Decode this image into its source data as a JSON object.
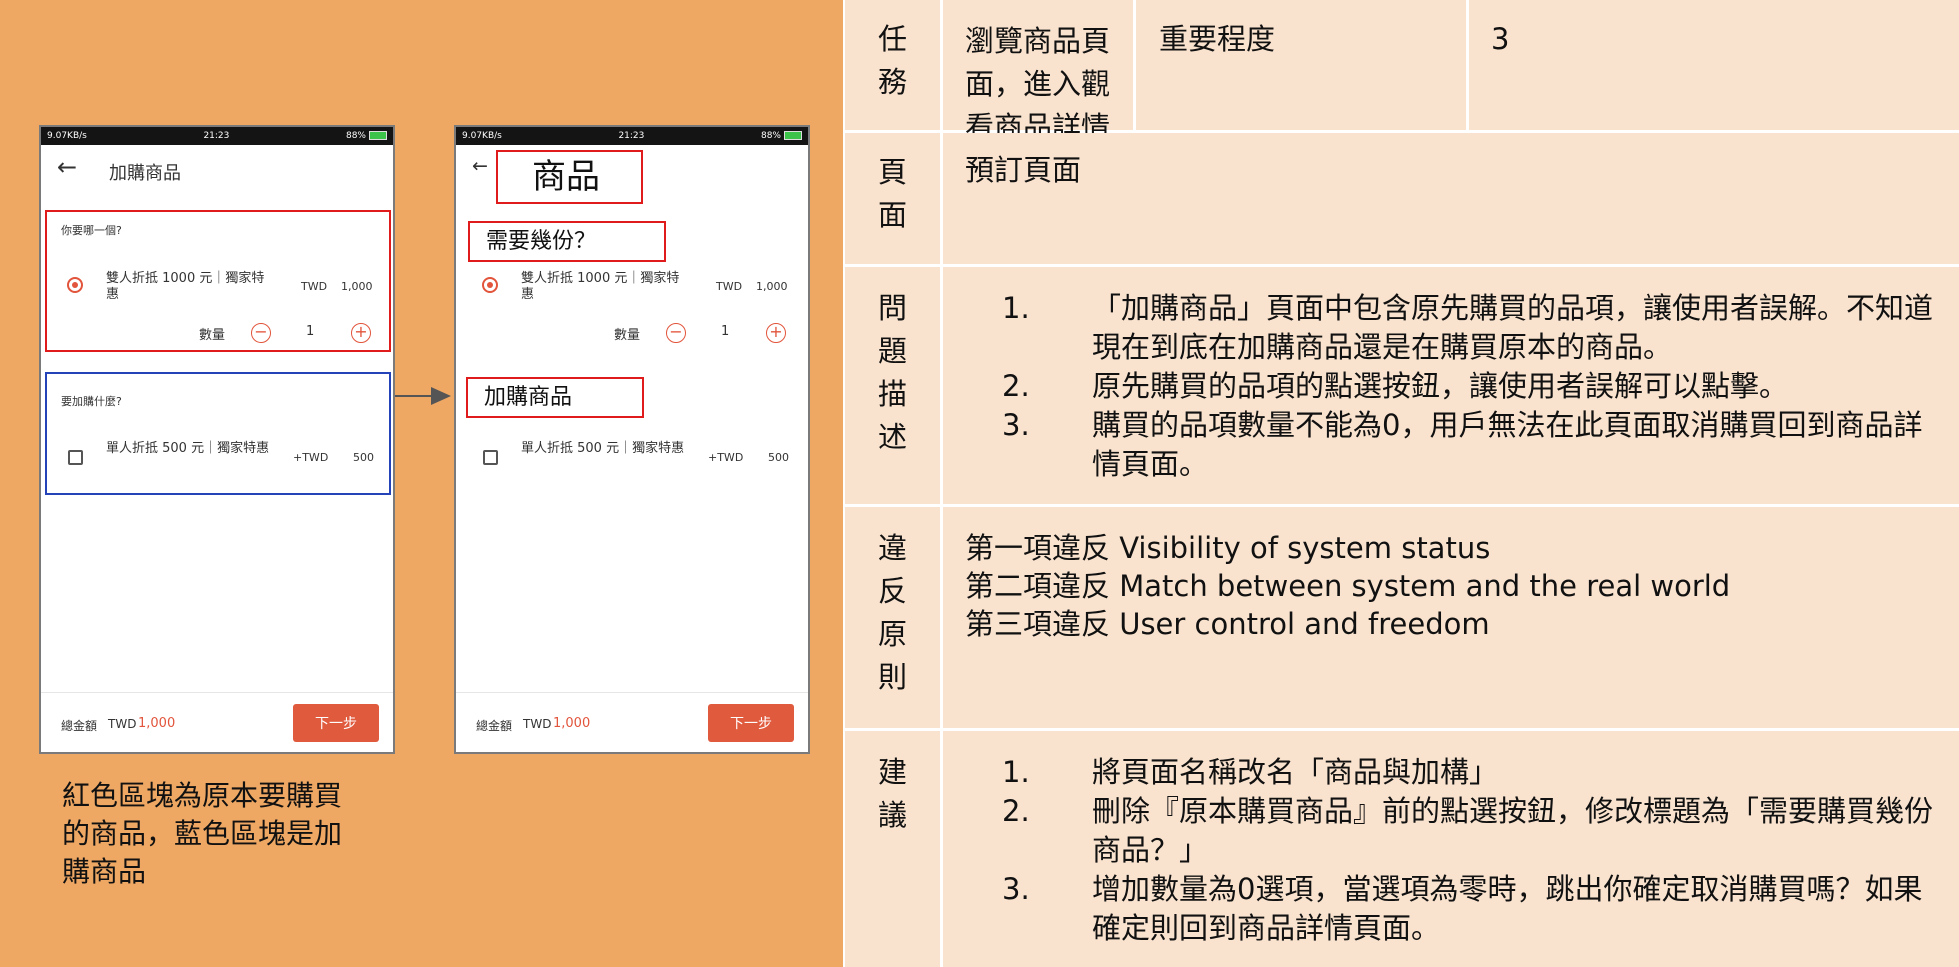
{
  "phone_left": {
    "status_left": "9.07KB/s",
    "status_time": "21:23",
    "status_right": "88%",
    "back_arrow": "←",
    "title": "加購商品",
    "section1_label": "你要哪一個?",
    "item1_name": "雙人折抵 1000 元｜獨家特惠",
    "item1_currency": "TWD",
    "item1_price": "1,000",
    "qty_label": "數量",
    "qty_minus": "−",
    "qty_value": "1",
    "qty_plus": "+",
    "section2_label": "要加購什麼?",
    "item2_name": "單人折抵 500 元｜獨家特惠",
    "item2_currency": "+TWD",
    "item2_price": "500",
    "total_label": "總金額",
    "total_currency": "TWD",
    "total_value": "1,000",
    "next_button": "下一步"
  },
  "phone_right": {
    "status_left": "9.07KB/s",
    "status_time": "21:23",
    "status_right": "88%",
    "back_arrow": "←",
    "title_callout": "商品",
    "section1_callout": "需要幾份？",
    "item1_name": "雙人折抵 1000 元｜獨家特惠",
    "item1_currency": "TWD",
    "item1_price": "1,000",
    "qty_label": "數量",
    "qty_minus": "−",
    "qty_value": "1",
    "qty_plus": "+",
    "section2_callout": "加購商品",
    "item2_name": "單人折抵 500 元｜獨家特惠",
    "item2_currency": "+TWD",
    "item2_price": "500",
    "total_label": "總金額",
    "total_currency": "TWD",
    "total_value": "1,000",
    "next_button": "下一步"
  },
  "caption": "紅色區塊為原本要購買的商品，藍色區塊是加購商品",
  "table": {
    "task_header": [
      "任",
      "務"
    ],
    "task_value": "瀏覽商品頁面，進入觀看商品詳情並預訂",
    "importance_label": "重要程度",
    "importance_value": "3",
    "page_header": [
      "頁",
      "面"
    ],
    "page_value": "預訂頁面",
    "problem_header": [
      "問",
      "題",
      "描",
      "述"
    ],
    "problems": [
      {
        "num": "1.",
        "text": "「加購商品」頁面中包含原先購買的品項，讓使用者誤解。不知道現在到底在加購商品還是在購買原本的商品。"
      },
      {
        "num": "2.",
        "text": "原先購買的品項的點選按鈕，讓使用者誤解可以點擊。"
      },
      {
        "num": "3.",
        "text": "購買的品項數量不能為0，用戶無法在此頁面取消購買回到商品詳情頁面。"
      }
    ],
    "violation_header": [
      "違",
      "反",
      "原",
      "則"
    ],
    "violations": [
      "第一項違反 Visibility of system status",
      "第二項違反 Match between system and the real world",
      "第三項違反 User control and freedom"
    ],
    "suggestion_header": [
      "建",
      "議"
    ],
    "suggestions": [
      {
        "num": "1.",
        "text": "將頁面名稱改名「商品與加構」"
      },
      {
        "num": "2.",
        "text": "刪除『原本購買商品』前的點選按鈕，修改標題為「需要購買幾份商品？」"
      },
      {
        "num": "3.",
        "text": "增加數量為0選項，當選項為零時，跳出你確定取消購買嗎？如果確定則回到商品詳情頁面。"
      }
    ]
  },
  "colors": {
    "left_background": "#eea864",
    "table_cell": "#f9e3cf",
    "highlight_red": "#e01b1b",
    "highlight_blue": "#2543b8",
    "accent": "#e05a3e"
  }
}
